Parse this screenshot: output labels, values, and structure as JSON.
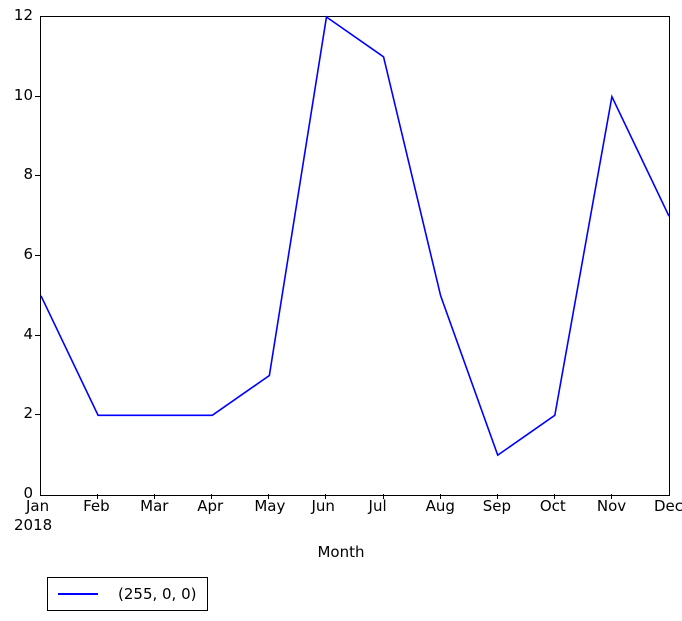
{
  "chart_data": {
    "type": "line",
    "title": "",
    "xlabel": "Month",
    "ylabel": "",
    "categories": [
      "Jan",
      "Feb",
      "Mar",
      "Apr",
      "May",
      "Jun",
      "Jul",
      "Aug",
      "Sep",
      "Oct",
      "Nov",
      "Dec"
    ],
    "x_sub_label": "2018",
    "series": [
      {
        "name": "(255, 0, 0)",
        "color": "#0000ff",
        "values": [
          5,
          2,
          2,
          2,
          3,
          12,
          11,
          5,
          1,
          2,
          10,
          7
        ]
      }
    ],
    "xlim": [
      0,
      11
    ],
    "ylim": [
      0,
      12
    ],
    "yticks": [
      0,
      2,
      4,
      6,
      8,
      10,
      12
    ],
    "ytick_labels": [
      "0",
      "2",
      "4",
      "6",
      "8",
      "10",
      "12"
    ],
    "xticks": [
      0,
      1,
      2,
      3,
      4,
      5,
      6,
      7,
      8,
      9,
      10,
      11
    ],
    "grid": false,
    "legend": {
      "position": "below-left",
      "entries": [
        {
          "label": "(255, 0, 0)",
          "color": "#0000ff"
        }
      ]
    }
  },
  "figure": {
    "background": "#ffffff",
    "axes_edge_color": "#000000"
  }
}
